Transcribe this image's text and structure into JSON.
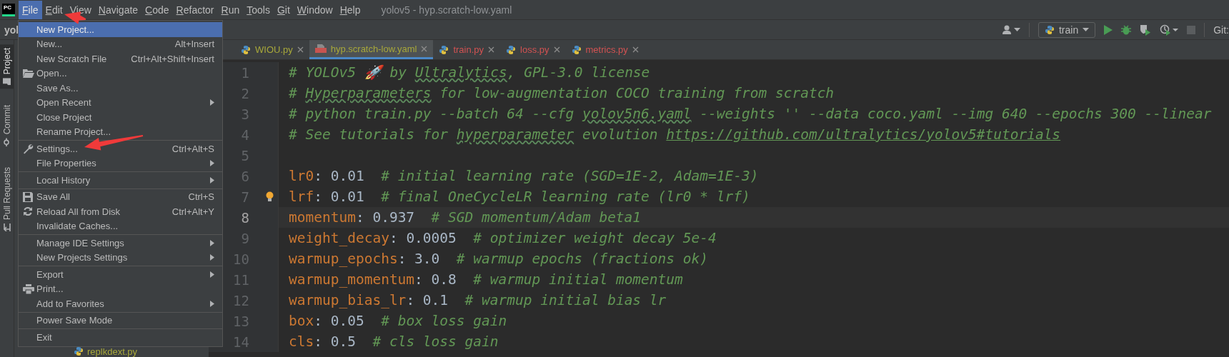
{
  "window": {
    "logo": "PC",
    "title": "yolov5 - hyp.scratch-low.yaml"
  },
  "menu_bar": [
    {
      "label": "File",
      "selected": true
    },
    {
      "label": "Edit",
      "selected": false
    },
    {
      "label": "View",
      "selected": false
    },
    {
      "label": "Navigate",
      "selected": false
    },
    {
      "label": "Code",
      "selected": false
    },
    {
      "label": "Refactor",
      "selected": false
    },
    {
      "label": "Run",
      "selected": false
    },
    {
      "label": "Tools",
      "selected": false
    },
    {
      "label": "Git",
      "selected": false
    },
    {
      "label": "Window",
      "selected": false
    },
    {
      "label": "Help",
      "selected": false
    }
  ],
  "navigation": {
    "project": "yol"
  },
  "toolbar": {
    "run_config": "train",
    "vcs_label": "Git:"
  },
  "tool_strip": [
    {
      "label": "Project",
      "kind": "project",
      "selected": true
    },
    {
      "label": "Commit",
      "kind": "commit",
      "selected": false
    },
    {
      "label": "Pull Requests",
      "kind": "pull",
      "selected": false
    }
  ],
  "project_panel": {
    "items": [
      {
        "label": "replkdext.py"
      }
    ]
  },
  "file_menu": {
    "groups": [
      [
        {
          "label": "New Project...",
          "kind": "plain",
          "submenu": false,
          "selected": true
        },
        {
          "label": "New...",
          "shortcut": "Alt+Insert",
          "kind": "plain",
          "submenu": false,
          "selected": false
        },
        {
          "label": "New Scratch File",
          "shortcut": "Ctrl+Alt+Shift+Insert",
          "kind": "plain",
          "submenu": false,
          "selected": false
        },
        {
          "label": "Open...",
          "kind": "open",
          "submenu": false,
          "selected": false
        },
        {
          "label": "Save As...",
          "kind": "plain",
          "submenu": false,
          "selected": false
        },
        {
          "label": "Open Recent",
          "kind": "plain",
          "submenu": true,
          "selected": false
        },
        {
          "label": "Close Project",
          "kind": "plain",
          "submenu": false,
          "selected": false
        },
        {
          "label": "Rename Project...",
          "kind": "plain",
          "submenu": false,
          "selected": false
        }
      ],
      [
        {
          "label": "Settings...",
          "shortcut": "Ctrl+Alt+S",
          "kind": "settings",
          "submenu": false,
          "selected": false
        },
        {
          "label": "File Properties",
          "kind": "plain",
          "submenu": true,
          "selected": false
        }
      ],
      [
        {
          "label": "Local History",
          "kind": "plain",
          "submenu": true,
          "selected": false
        }
      ],
      [
        {
          "label": "Save All",
          "shortcut": "Ctrl+S",
          "kind": "save",
          "submenu": false,
          "selected": false
        },
        {
          "label": "Reload All from Disk",
          "shortcut": "Ctrl+Alt+Y",
          "kind": "reload",
          "submenu": false,
          "selected": false
        },
        {
          "label": "Invalidate Caches...",
          "kind": "plain",
          "submenu": false,
          "selected": false
        }
      ],
      [
        {
          "label": "Manage IDE Settings",
          "kind": "plain",
          "submenu": true,
          "selected": false
        },
        {
          "label": "New Projects Settings",
          "kind": "plain",
          "submenu": true,
          "selected": false
        }
      ],
      [
        {
          "label": "Export",
          "kind": "plain",
          "submenu": true,
          "selected": false
        },
        {
          "label": "Print...",
          "kind": "print",
          "submenu": false,
          "selected": false
        },
        {
          "label": "Add to Favorites",
          "kind": "plain",
          "submenu": true,
          "selected": false
        }
      ],
      [
        {
          "label": "Power Save Mode",
          "kind": "plain",
          "submenu": false,
          "selected": false
        }
      ],
      [
        {
          "label": "Exit",
          "kind": "plain",
          "submenu": false,
          "selected": false
        }
      ]
    ]
  },
  "editor": {
    "tabs": [
      {
        "label": "WIOU.py",
        "kind": "python",
        "selected": false,
        "color": "#a8a83a"
      },
      {
        "label": "hyp.scratch-low.yaml",
        "kind": "yaml",
        "selected": true,
        "color": "#a8a83a"
      },
      {
        "label": "train.py",
        "kind": "python",
        "selected": false,
        "color": "#d25252"
      },
      {
        "label": "loss.py",
        "kind": "python",
        "selected": false,
        "color": "#d25252"
      },
      {
        "label": "metrics.py",
        "kind": "python",
        "selected": false,
        "color": "#d25252"
      }
    ],
    "lines": [
      {
        "number": "1",
        "current": false,
        "hint": false,
        "tokens": [
          {
            "kind": "comment",
            "text": "# YOLOv5 🚀 by "
          },
          {
            "kind": "typo",
            "text": "Ultralytics"
          },
          {
            "kind": "comment",
            "text": ", GPL-3.0 license"
          }
        ]
      },
      {
        "number": "2",
        "current": false,
        "hint": false,
        "tokens": [
          {
            "kind": "comment",
            "text": "# "
          },
          {
            "kind": "typo",
            "text": "Hyperparameters"
          },
          {
            "kind": "comment",
            "text": " for low-augmentation COCO training from scratch"
          }
        ]
      },
      {
        "number": "3",
        "current": false,
        "hint": false,
        "tokens": [
          {
            "kind": "comment",
            "text": "# python train.py --batch 64 --cfg "
          },
          {
            "kind": "typo",
            "text": "yolov5n6.yaml"
          },
          {
            "kind": "comment",
            "text": " --weights '' --data coco.yaml --img 640 --epochs 300 --linear"
          }
        ]
      },
      {
        "number": "4",
        "current": false,
        "hint": false,
        "tokens": [
          {
            "kind": "comment",
            "text": "# See tutorials for "
          },
          {
            "kind": "typo",
            "text": "hyperparameter"
          },
          {
            "kind": "comment",
            "text": " evolution "
          },
          {
            "kind": "link",
            "text": "https://github.com/ultralytics/yolov5#tutorials"
          }
        ]
      },
      {
        "number": "5",
        "current": false,
        "hint": false
      },
      {
        "number": "6",
        "current": false,
        "hint": false,
        "tokens": [
          {
            "kind": "key",
            "text": "lr0"
          },
          {
            "kind": "punct",
            "text": ": "
          },
          {
            "kind": "value",
            "text": "0.01"
          },
          {
            "kind": "comment",
            "text": "  # initial learning rate (SGD=1E-2, Adam=1E-3)"
          }
        ]
      },
      {
        "number": "7",
        "current": false,
        "hint": true,
        "tokens": [
          {
            "kind": "key",
            "text": "lrf"
          },
          {
            "kind": "punct",
            "text": ": "
          },
          {
            "kind": "value",
            "text": "0.01"
          },
          {
            "kind": "comment",
            "text": "  # final OneCycleLR learning rate (lr0 * lrf)"
          }
        ]
      },
      {
        "number": "8",
        "current": true,
        "hint": false,
        "tokens": [
          {
            "kind": "key",
            "text": "momentum"
          },
          {
            "kind": "punct",
            "text": ": "
          },
          {
            "kind": "value",
            "text": "0.937"
          },
          {
            "kind": "comment",
            "text": "  # SGD momentum/Adam beta1"
          }
        ]
      },
      {
        "number": "9",
        "current": false,
        "hint": false,
        "tokens": [
          {
            "kind": "key",
            "text": "weight_decay"
          },
          {
            "kind": "punct",
            "text": ": "
          },
          {
            "kind": "value",
            "text": "0.0005"
          },
          {
            "kind": "comment",
            "text": "  # optimizer weight decay 5e-4"
          }
        ]
      },
      {
        "number": "10",
        "current": false,
        "hint": false,
        "tokens": [
          {
            "kind": "key",
            "text": "warmup_epochs"
          },
          {
            "kind": "punct",
            "text": ": "
          },
          {
            "kind": "value",
            "text": "3.0"
          },
          {
            "kind": "comment",
            "text": "  # warmup epochs (fractions ok)"
          }
        ]
      },
      {
        "number": "11",
        "current": false,
        "hint": false,
        "tokens": [
          {
            "kind": "key",
            "text": "warmup_momentum"
          },
          {
            "kind": "punct",
            "text": ": "
          },
          {
            "kind": "value",
            "text": "0.8"
          },
          {
            "kind": "comment",
            "text": "  # warmup initial momentum"
          }
        ]
      },
      {
        "number": "12",
        "current": false,
        "hint": false,
        "tokens": [
          {
            "kind": "key",
            "text": "warmup_bias_lr"
          },
          {
            "kind": "punct",
            "text": ": "
          },
          {
            "kind": "value",
            "text": "0.1"
          },
          {
            "kind": "comment",
            "text": "  # warmup initial bias lr"
          }
        ]
      },
      {
        "number": "13",
        "current": false,
        "hint": false,
        "tokens": [
          {
            "kind": "key",
            "text": "box"
          },
          {
            "kind": "punct",
            "text": ": "
          },
          {
            "kind": "value",
            "text": "0.05"
          },
          {
            "kind": "comment",
            "text": "  # box loss gain"
          }
        ]
      },
      {
        "number": "14",
        "current": false,
        "hint": false,
        "tokens": [
          {
            "kind": "key",
            "text": "cls"
          },
          {
            "kind": "punct",
            "text": ": "
          },
          {
            "kind": "value",
            "text": "0.5"
          },
          {
            "kind": "comment",
            "text": "  # cls loss gain"
          }
        ]
      }
    ]
  }
}
